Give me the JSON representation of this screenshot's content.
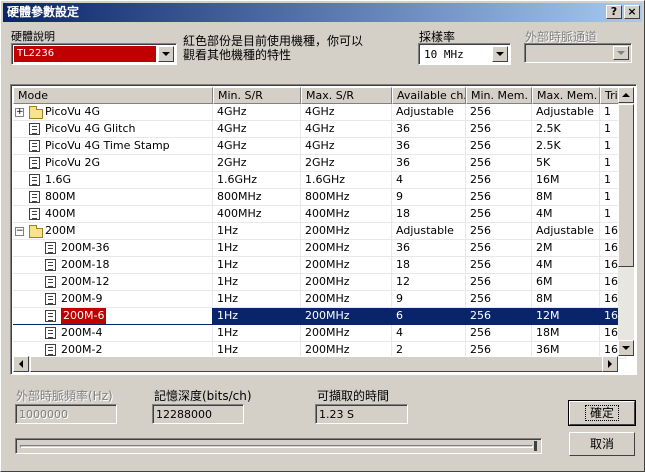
{
  "window": {
    "title": "硬體參數設定",
    "help_label": "?",
    "close_label": "×"
  },
  "hardware": {
    "label": "硬體說明",
    "selected": "TL2236",
    "note_line1": "紅色部份是目前使用機種，你可以",
    "note_line2": "觀看其他機種的特性"
  },
  "sample_rate": {
    "label": "採樣率",
    "selected": "10 MHz"
  },
  "ext_clock_channel": {
    "label": "外部時脈通道",
    "selected": ""
  },
  "table": {
    "columns": [
      "Mode",
      "Min. S/R",
      "Max. S/R",
      "Available ch.",
      "Min. Mem.",
      "Max. Mem.",
      "Trig"
    ],
    "rows": [
      {
        "mode": "PicoVu 4G",
        "min_sr": "4GHz",
        "max_sr": "4GHz",
        "ch": "Adjustable",
        "min_mem": "256",
        "max_mem": "Adjustable",
        "trig": "1",
        "icon": "folder",
        "expander": "+",
        "indent": 0,
        "selected": false,
        "highlight": false
      },
      {
        "mode": "PicoVu 4G Glitch",
        "min_sr": "4GHz",
        "max_sr": "4GHz",
        "ch": "36",
        "min_mem": "256",
        "max_mem": "2.5K",
        "trig": "1",
        "icon": "doc",
        "expander": "",
        "indent": 0,
        "selected": false,
        "highlight": false
      },
      {
        "mode": "PicoVu 4G Time Stamp",
        "min_sr": "4GHz",
        "max_sr": "4GHz",
        "ch": "36",
        "min_mem": "256",
        "max_mem": "2.5K",
        "trig": "1",
        "icon": "doc",
        "expander": "",
        "indent": 0,
        "selected": false,
        "highlight": false
      },
      {
        "mode": "PicoVu 2G",
        "min_sr": "2GHz",
        "max_sr": "2GHz",
        "ch": "36",
        "min_mem": "256",
        "max_mem": "5K",
        "trig": "1",
        "icon": "doc",
        "expander": "",
        "indent": 0,
        "selected": false,
        "highlight": false
      },
      {
        "mode": "1.6G",
        "min_sr": "1.6GHz",
        "max_sr": "1.6GHz",
        "ch": "4",
        "min_mem": "256",
        "max_mem": "16M",
        "trig": "1",
        "icon": "doc",
        "expander": "",
        "indent": 0,
        "selected": false,
        "highlight": false
      },
      {
        "mode": "800M",
        "min_sr": "800MHz",
        "max_sr": "800MHz",
        "ch": "9",
        "min_mem": "256",
        "max_mem": "8M",
        "trig": "1",
        "icon": "doc",
        "expander": "",
        "indent": 0,
        "selected": false,
        "highlight": false
      },
      {
        "mode": "400M",
        "min_sr": "400MHz",
        "max_sr": "400MHz",
        "ch": "18",
        "min_mem": "256",
        "max_mem": "4M",
        "trig": "1",
        "icon": "doc",
        "expander": "",
        "indent": 0,
        "selected": false,
        "highlight": false
      },
      {
        "mode": "200M",
        "min_sr": "1Hz",
        "max_sr": "200MHz",
        "ch": "Adjustable",
        "min_mem": "256",
        "max_mem": "Adjustable",
        "trig": "16",
        "icon": "folder-open",
        "expander": "−",
        "indent": 0,
        "selected": false,
        "highlight": false
      },
      {
        "mode": "200M-36",
        "min_sr": "1Hz",
        "max_sr": "200MHz",
        "ch": "36",
        "min_mem": "256",
        "max_mem": "2M",
        "trig": "16",
        "icon": "doc",
        "expander": "",
        "indent": 1,
        "selected": false,
        "highlight": false
      },
      {
        "mode": "200M-18",
        "min_sr": "1Hz",
        "max_sr": "200MHz",
        "ch": "18",
        "min_mem": "256",
        "max_mem": "4M",
        "trig": "16",
        "icon": "doc",
        "expander": "",
        "indent": 1,
        "selected": false,
        "highlight": false
      },
      {
        "mode": "200M-12",
        "min_sr": "1Hz",
        "max_sr": "200MHz",
        "ch": "12",
        "min_mem": "256",
        "max_mem": "6M",
        "trig": "16",
        "icon": "doc",
        "expander": "",
        "indent": 1,
        "selected": false,
        "highlight": false
      },
      {
        "mode": "200M-9",
        "min_sr": "1Hz",
        "max_sr": "200MHz",
        "ch": "9",
        "min_mem": "256",
        "max_mem": "8M",
        "trig": "16",
        "icon": "doc",
        "expander": "",
        "indent": 1,
        "selected": false,
        "highlight": false
      },
      {
        "mode": "200M-6",
        "min_sr": "1Hz",
        "max_sr": "200MHz",
        "ch": "6",
        "min_mem": "256",
        "max_mem": "12M",
        "trig": "16",
        "icon": "doc",
        "expander": "",
        "indent": 1,
        "selected": true,
        "highlight": true
      },
      {
        "mode": "200M-4",
        "min_sr": "1Hz",
        "max_sr": "200MHz",
        "ch": "4",
        "min_mem": "256",
        "max_mem": "18M",
        "trig": "16",
        "icon": "doc",
        "expander": "",
        "indent": 1,
        "selected": false,
        "highlight": false
      },
      {
        "mode": "200M-2",
        "min_sr": "1Hz",
        "max_sr": "200MHz",
        "ch": "2",
        "min_mem": "256",
        "max_mem": "36M",
        "trig": "16",
        "icon": "doc",
        "expander": "",
        "indent": 1,
        "selected": false,
        "highlight": false
      }
    ]
  },
  "ext_clock_freq": {
    "label": "外部時脈頻率(Hz)",
    "value": "1000000"
  },
  "memory_depth": {
    "label": "記憶深度(bits/ch)",
    "value": "12288000"
  },
  "capture_time": {
    "label": "可擷取的時間",
    "value": "1.23 S"
  },
  "buttons": {
    "ok": "確定",
    "cancel": "取消"
  }
}
